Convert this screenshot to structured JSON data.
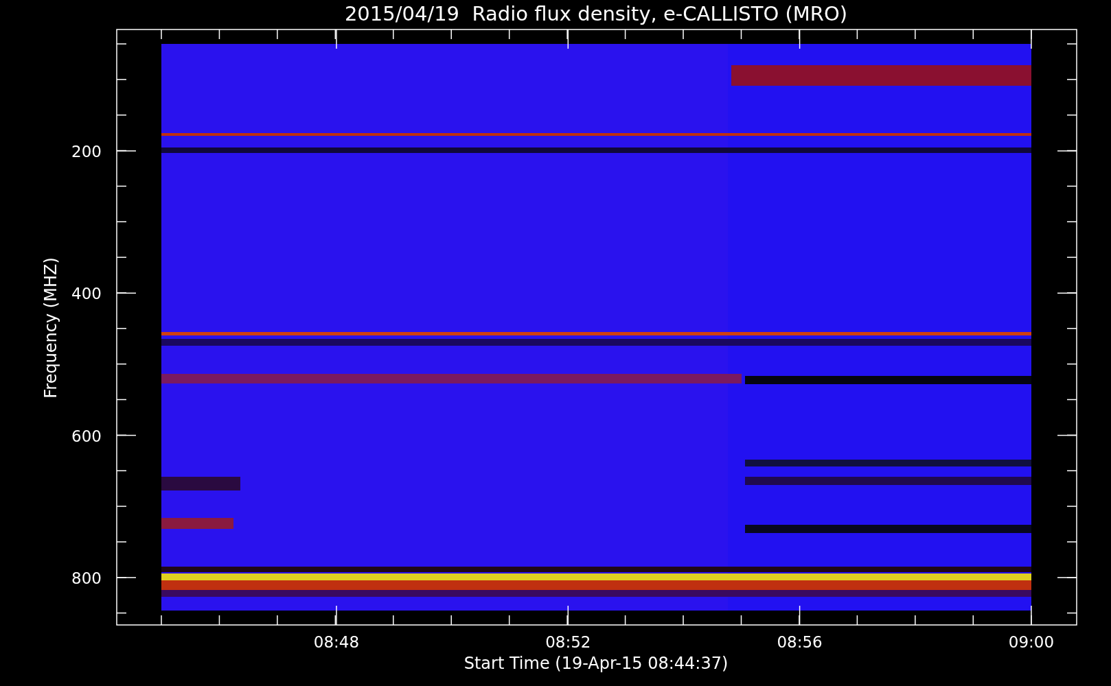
{
  "title": "2015/04/19  Radio flux density, e-CALLISTO (MRO)",
  "y_axis": {
    "label": "Frequency (MHZ)",
    "ticks": [
      "200",
      "400",
      "600",
      "800"
    ]
  },
  "x_axis": {
    "label": "Start Time (19-Apr-15 08:44:37)",
    "ticks": [
      "08:48",
      "08:52",
      "08:56",
      "09:00"
    ]
  }
}
